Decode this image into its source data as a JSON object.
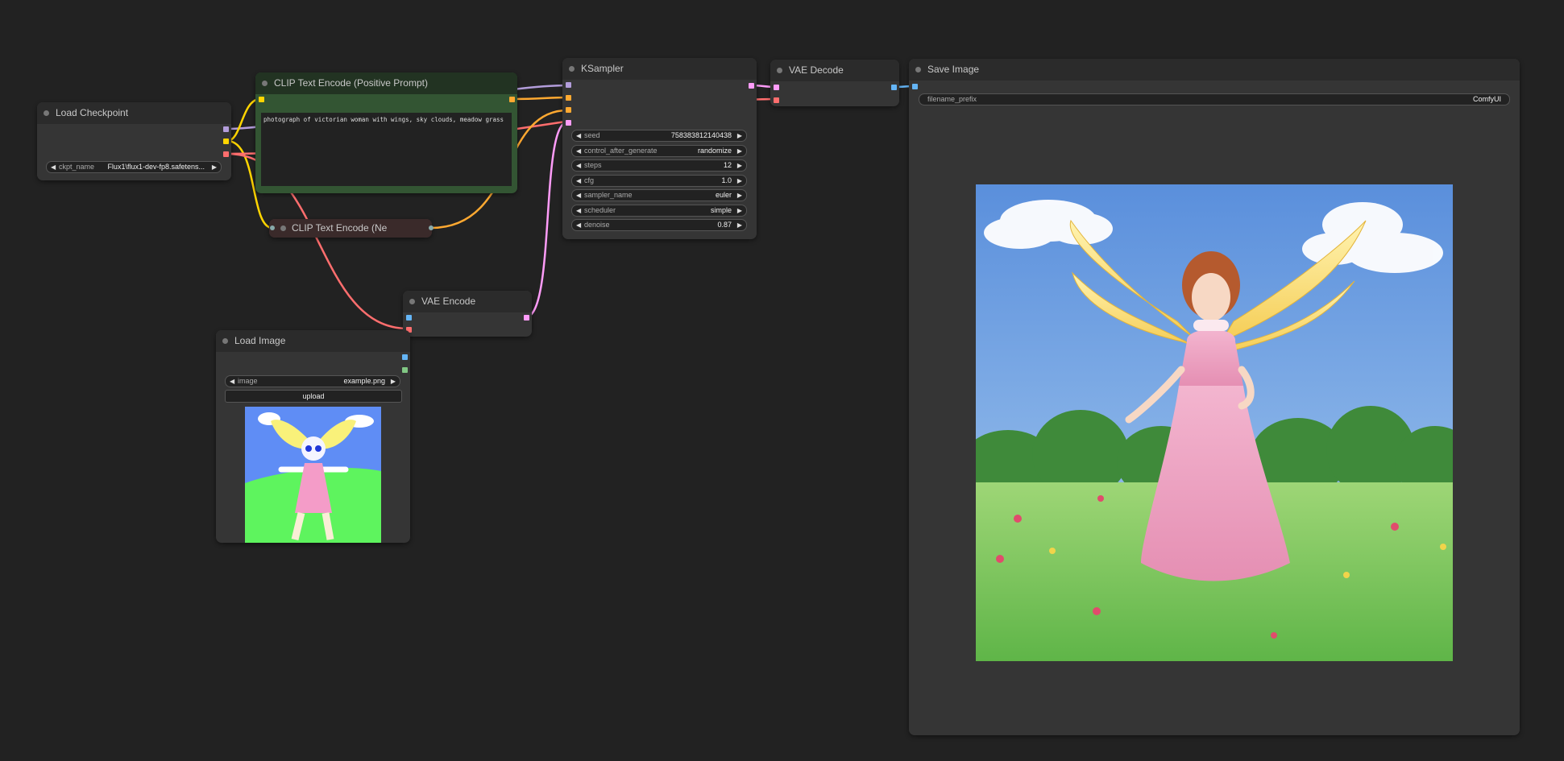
{
  "colors": {
    "canvas_bg": "#222222",
    "node_bg": "#353535",
    "node_title_bg": "#2b2b2b",
    "clip_positive_bg": "#335533",
    "clip_negative_bg": "#3a2a2a",
    "wire_clip": "#ffd500",
    "wire_model": "#b39ddb",
    "wire_vae": "#ff6e6e",
    "wire_conditioning": "#ffa931",
    "wire_latent": "#ff9cf9",
    "wire_image": "#64b5f6",
    "wire_mask": "#81c784"
  },
  "nodes": {
    "load_checkpoint": {
      "title": "Load Checkpoint",
      "ckpt_label": "ckpt_name",
      "ckpt_value": "Flux1\\flux1-dev-fp8.safetens..."
    },
    "clip_positive": {
      "title": "CLIP Text Encode (Positive Prompt)",
      "text": "photograph of victorian woman with wings, sky clouds, meadow grass"
    },
    "clip_negative": {
      "title": "CLIP Text Encode (Ne"
    },
    "ksampler": {
      "title": "KSampler",
      "widgets": [
        {
          "label": "seed",
          "value": "758383812140438"
        },
        {
          "label": "control_after_generate",
          "value": "randomize"
        },
        {
          "label": "steps",
          "value": "12"
        },
        {
          "label": "cfg",
          "value": "1.0"
        },
        {
          "label": "sampler_name",
          "value": "euler"
        },
        {
          "label": "scheduler",
          "value": "simple"
        },
        {
          "label": "denoise",
          "value": "0.87"
        }
      ]
    },
    "vae_decode": {
      "title": "VAE Decode"
    },
    "vae_encode": {
      "title": "VAE Encode"
    },
    "save_image": {
      "title": "Save Image",
      "prefix_label": "filename_prefix",
      "prefix_value": "ComfyUI"
    },
    "load_image": {
      "title": "Load Image",
      "image_label": "image",
      "image_value": "example.png",
      "upload_label": "upload"
    }
  }
}
